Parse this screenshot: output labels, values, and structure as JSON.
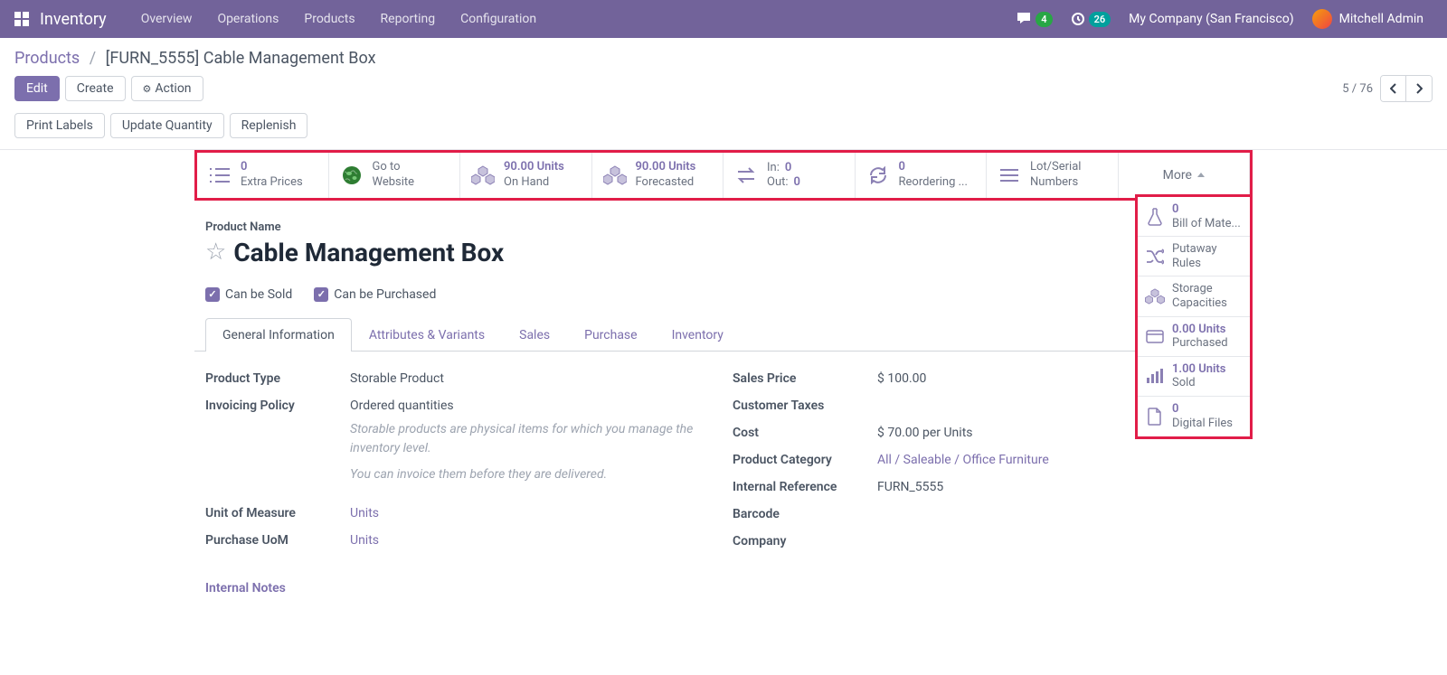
{
  "nav": {
    "brand": "Inventory",
    "items": [
      "Overview",
      "Operations",
      "Products",
      "Reporting",
      "Configuration"
    ],
    "msg_count": "4",
    "act_count": "26",
    "company": "My Company (San Francisco)",
    "user": "Mitchell Admin"
  },
  "crumb": {
    "parent": "Products",
    "current": "[FURN_5555] Cable Management Box"
  },
  "toolbar": {
    "edit": "Edit",
    "create": "Create",
    "action": "Action",
    "pager": "5 / 76"
  },
  "actions": {
    "print": "Print Labels",
    "update": "Update Quantity",
    "replenish": "Replenish"
  },
  "stats": {
    "extra_prices": {
      "val": "0",
      "lbl": "Extra Prices"
    },
    "website": {
      "line1": "Go to",
      "line2": "Website"
    },
    "onhand": {
      "val": "90.00 Units",
      "lbl": "On Hand"
    },
    "forecast": {
      "val": "90.00 Units",
      "lbl": "Forecasted"
    },
    "in": {
      "k": "In:",
      "v": "0"
    },
    "out": {
      "k": "Out:",
      "v": "0"
    },
    "reorder": {
      "val": "0",
      "lbl": "Reordering ..."
    },
    "lot": {
      "line1": "Lot/Serial",
      "line2": "Numbers"
    },
    "more": "More"
  },
  "dropdown": {
    "bom": {
      "val": "0",
      "lbl": "Bill of Mate..."
    },
    "putaway": {
      "line1": "Putaway",
      "line2": "Rules"
    },
    "storage": {
      "line1": "Storage",
      "line2": "Capacities"
    },
    "purchased": {
      "val": "0.00 Units",
      "lbl": "Purchased"
    },
    "sold": {
      "val": "1.00 Units",
      "lbl": "Sold"
    },
    "digital": {
      "val": "0",
      "lbl": "Digital Files"
    }
  },
  "form": {
    "product_name_label": "Product Name",
    "title": "Cable Management Box",
    "can_sold": "Can be Sold",
    "can_purchased": "Can be Purchased",
    "tabs": [
      "General Information",
      "Attributes & Variants",
      "Sales",
      "Purchase",
      "Inventory"
    ],
    "left": {
      "product_type": {
        "lbl": "Product Type",
        "val": "Storable Product"
      },
      "invoicing": {
        "lbl": "Invoicing Policy",
        "val": "Ordered quantities"
      },
      "help1": "Storable products are physical items for which you manage the inventory level.",
      "help2": "You can invoice them before they are delivered.",
      "uom": {
        "lbl": "Unit of Measure",
        "val": "Units"
      },
      "puom": {
        "lbl": "Purchase UoM",
        "val": "Units"
      }
    },
    "right": {
      "sales_price": {
        "lbl": "Sales Price",
        "val": "$ 100.00"
      },
      "customer_taxes": {
        "lbl": "Customer Taxes",
        "val": ""
      },
      "cost": {
        "lbl": "Cost",
        "val": "$ 70.00 per Units"
      },
      "category": {
        "lbl": "Product Category",
        "val": "All / Saleable / Office Furniture"
      },
      "ref": {
        "lbl": "Internal Reference",
        "val": "FURN_5555"
      },
      "barcode": {
        "lbl": "Barcode",
        "val": ""
      },
      "company": {
        "lbl": "Company",
        "val": ""
      }
    },
    "notes": "Internal Notes"
  }
}
